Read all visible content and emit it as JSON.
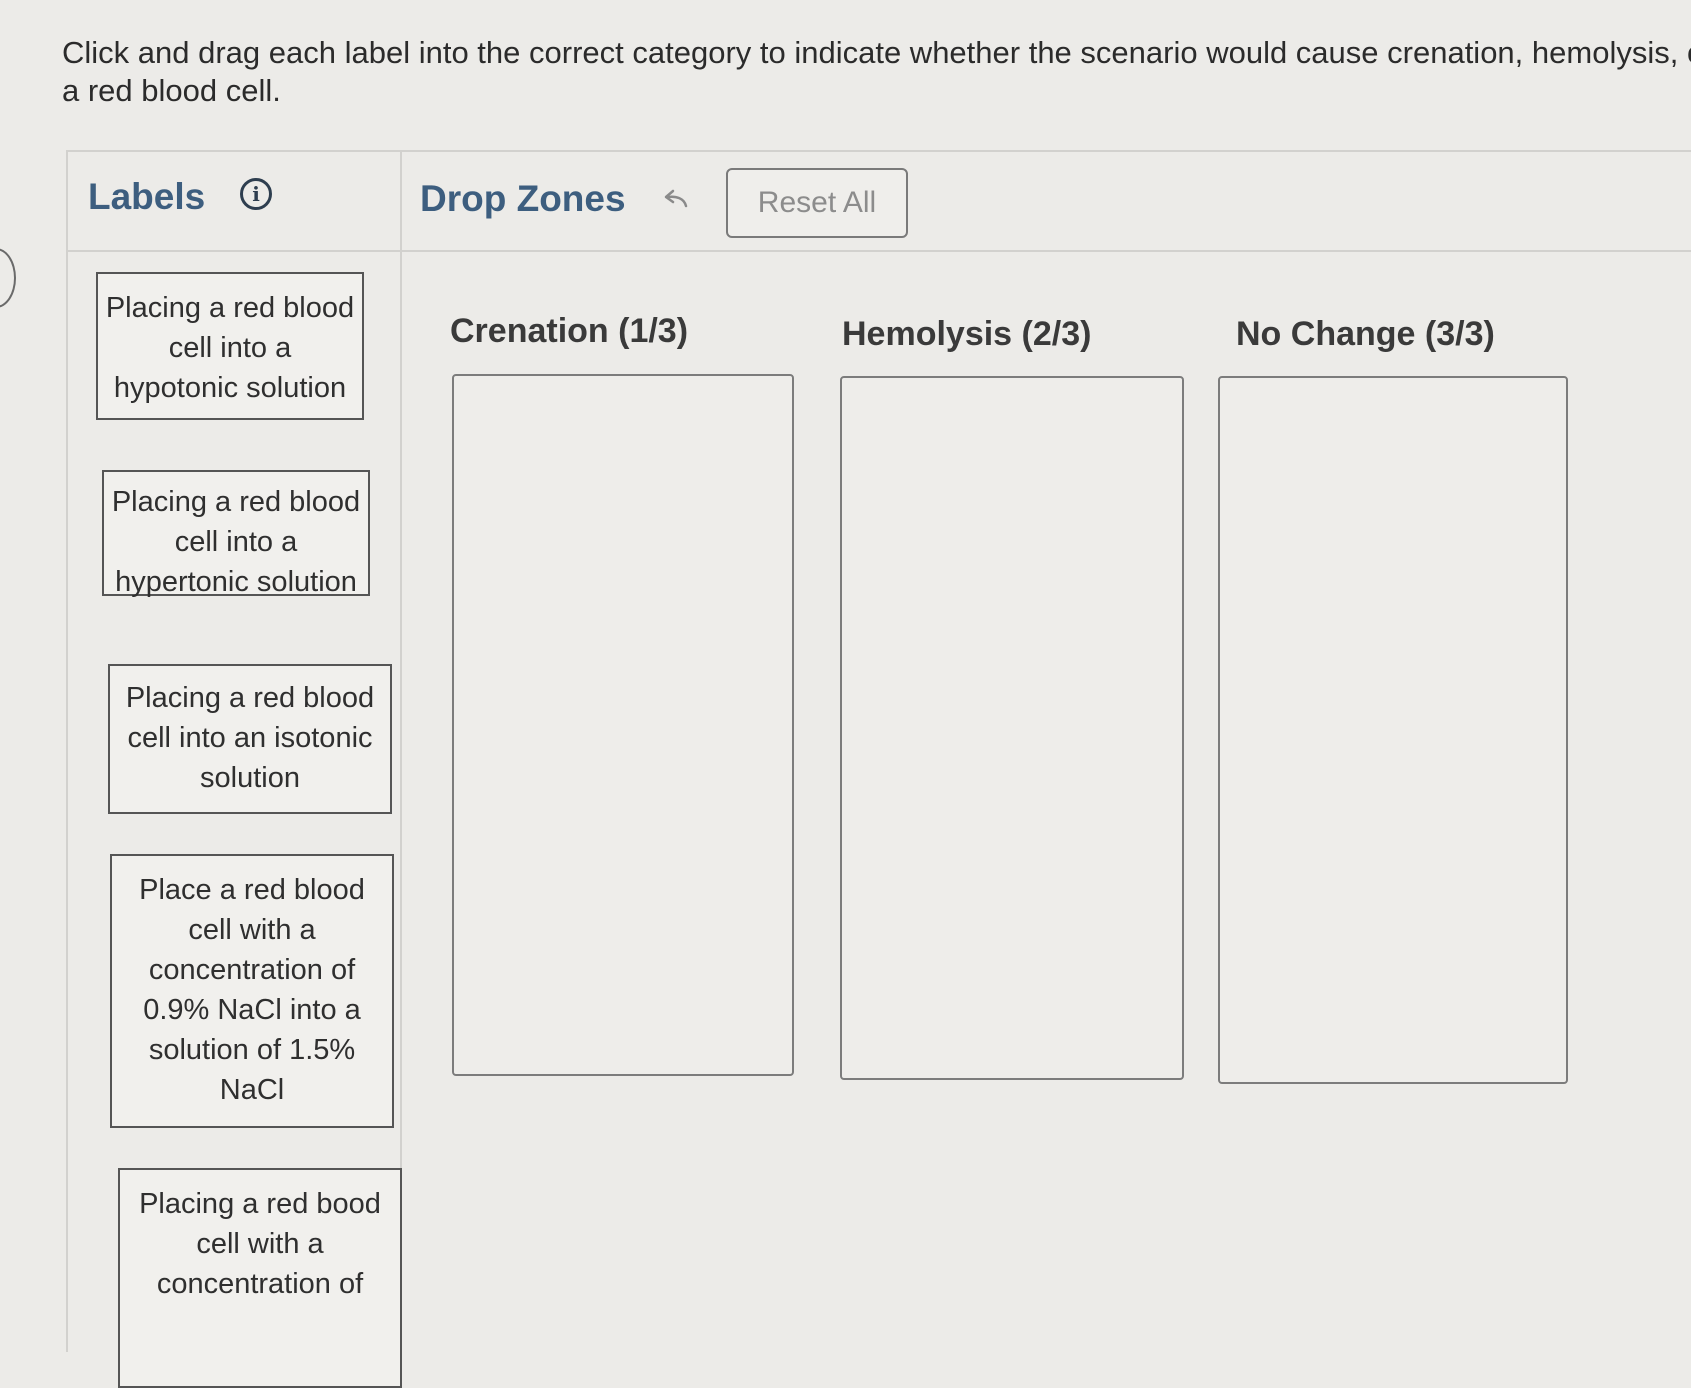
{
  "instructions": {
    "line1": "Click and drag each label into the correct category to indicate whether the scenario would cause crenation, hemolysis, or no change in",
    "line2": "a red blood cell."
  },
  "labels_panel": {
    "heading": "Labels",
    "info_icon": "info-icon",
    "items": [
      "Placing a red blood cell into a hypotonic solution",
      "Placing a red blood cell into a hypertonic solution",
      "Placing a red blood cell into an isotonic solution",
      "Place a red blood cell with a concentration of 0.9% NaCl into a solution of 1.5% NaCl",
      "Placing a red bood cell with a concentration of"
    ]
  },
  "drop_zones_panel": {
    "heading": "Drop Zones",
    "undo_icon": "undo-icon",
    "reset_label": "Reset All",
    "zones": [
      {
        "title": "Crenation (1/3)"
      },
      {
        "title": "Hemolysis (2/3)"
      },
      {
        "title": "No Change (3/3)"
      }
    ]
  },
  "colors": {
    "background": "#ecebe8",
    "heading_blue": "#3d5e7f",
    "border": "#555555"
  }
}
